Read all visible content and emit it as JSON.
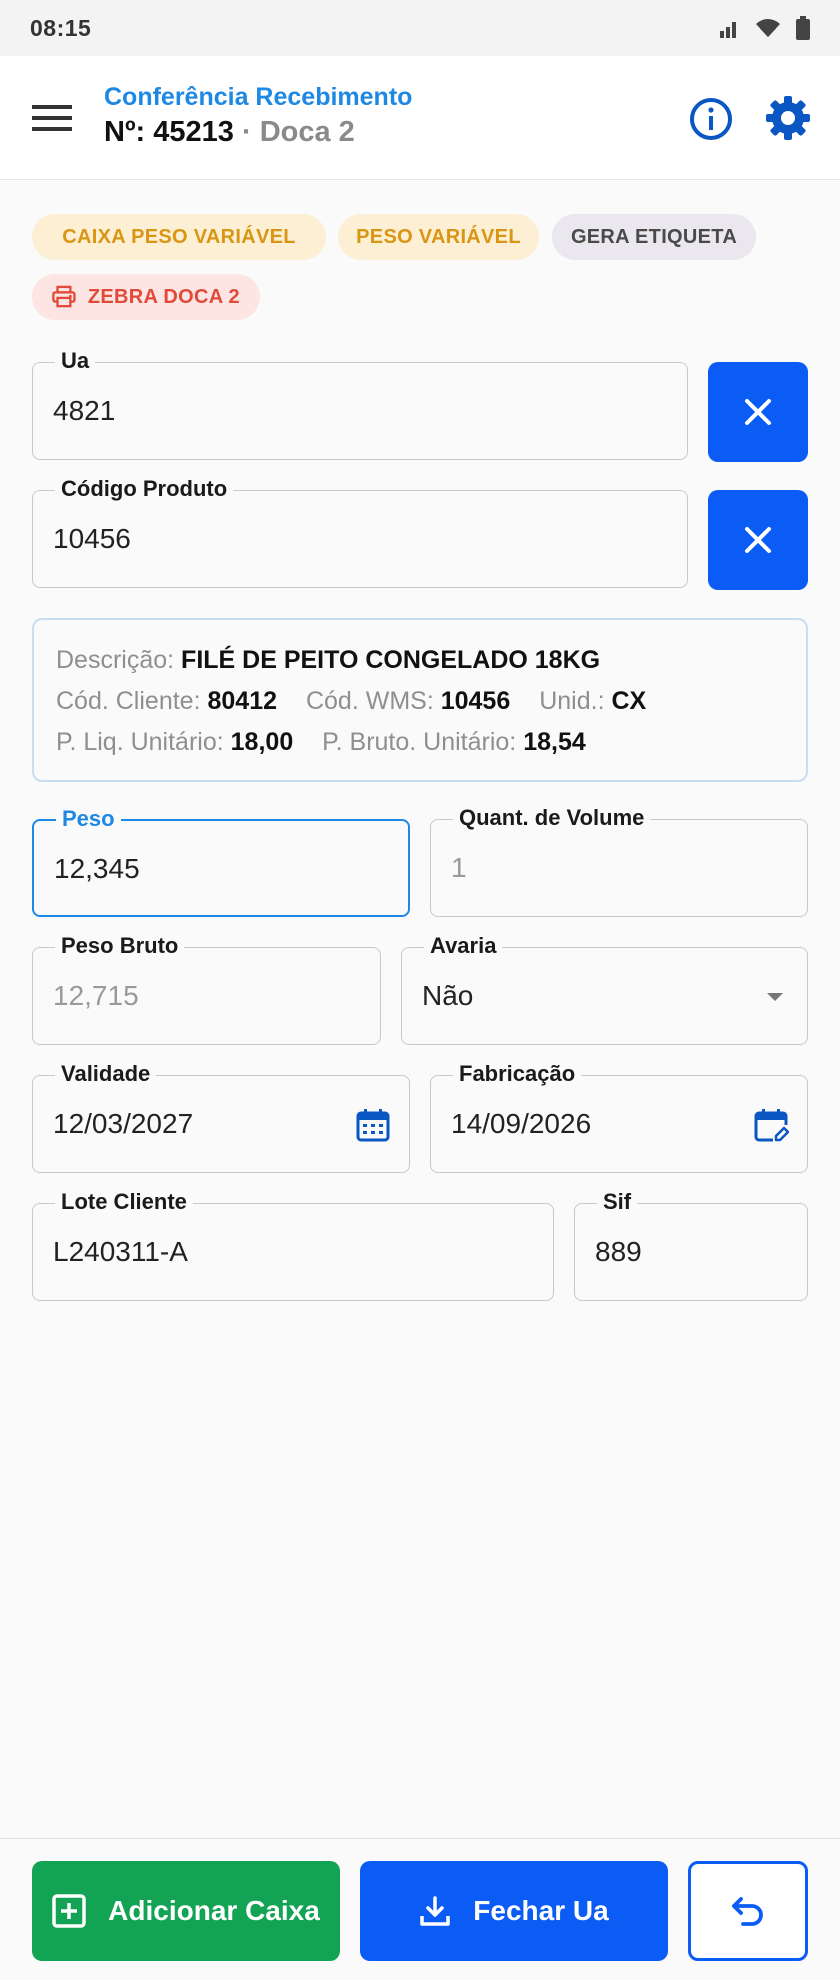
{
  "status_bar": {
    "time": "08:15"
  },
  "header": {
    "title": "Conferência Recebimento",
    "number_prefix": "Nº: ",
    "number": "45213",
    "separator": " · ",
    "dock": "Doca 2"
  },
  "chips": [
    {
      "label": "CAIXA PESO VARIÁVEL"
    },
    {
      "label": "PESO VARIÁVEL"
    },
    {
      "label": "GERA ETIQUETA"
    },
    {
      "label": "ZEBRA DOCA 2",
      "icon": "printer-icon"
    }
  ],
  "fields": {
    "ua": {
      "label": "Ua",
      "value": "4821"
    },
    "codigo_produto": {
      "label": "Código Produto",
      "value": "10456"
    },
    "peso": {
      "label": "Peso",
      "value": "12,345"
    },
    "quant_volume": {
      "label": "Quant. de Volume",
      "placeholder": "1"
    },
    "peso_bruto": {
      "label": "Peso Bruto",
      "value": "12,715"
    },
    "avaria": {
      "label": "Avaria",
      "value": "Não"
    },
    "validade": {
      "label": "Validade",
      "value": "12/03/2027"
    },
    "fabricacao": {
      "label": "Fabricação",
      "value": "14/09/2026"
    },
    "lote_cliente": {
      "label": "Lote Cliente",
      "value": "L240311-A"
    },
    "sif": {
      "label": "Sif",
      "value": "889"
    }
  },
  "product": {
    "descricao_label": "Descrição:",
    "descricao": "FILÉ DE PEITO CONGELADO 18KG",
    "cod_cliente_label": "Cód. Cliente:",
    "cod_cliente": "80412",
    "cod_wms_label": "Cód. WMS:",
    "cod_wms": "10456",
    "unid_label": "Unid.:",
    "unid": "CX",
    "p_liq_label": "P. Liq. Unitário:",
    "p_liq": "18,00",
    "p_bruto_label": "P. Bruto. Unitário:",
    "p_bruto": "18,54"
  },
  "actions": {
    "add_box": "Adicionar Caixa",
    "close_ua": "Fechar Ua"
  },
  "colors": {
    "primary": "#0a5cf5",
    "title_blue": "#1e88e5",
    "success": "#12a454",
    "chip_yellow_text": "#d89614",
    "chip_red_text": "#e14a38"
  }
}
